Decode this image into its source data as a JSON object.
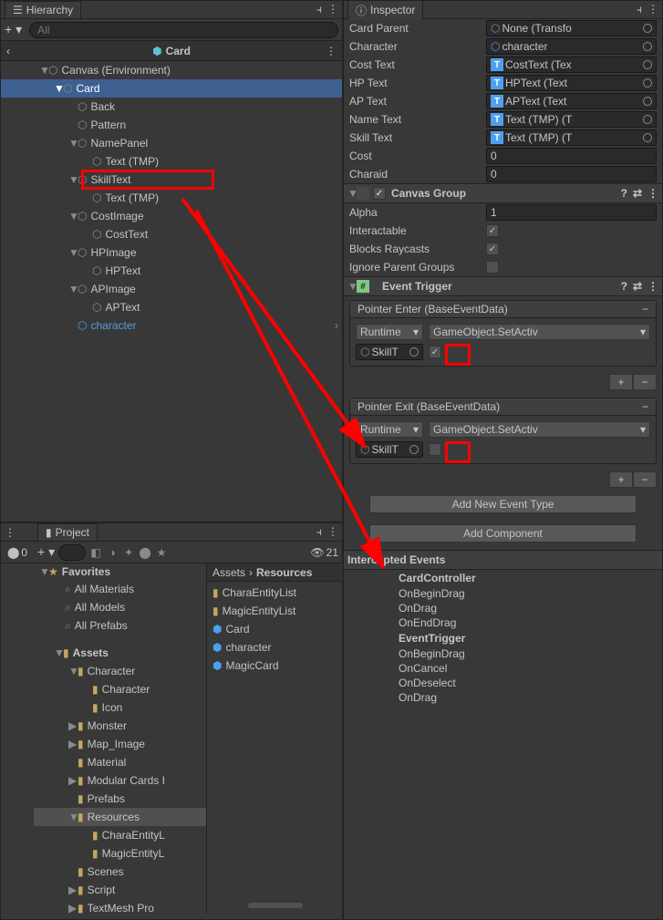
{
  "hierarchy": {
    "title": "Hierarchy",
    "searchPlaceholder": "All",
    "breadcrumb": "Card",
    "items": [
      {
        "label": "Canvas (Environment)",
        "indent": 2,
        "prefab": false,
        "expand": "▼"
      },
      {
        "label": "Card",
        "indent": 3,
        "prefab": false,
        "expand": "▼",
        "selected": true
      },
      {
        "label": "Back",
        "indent": 4,
        "prefab": false,
        "expand": ""
      },
      {
        "label": "Pattern",
        "indent": 4,
        "prefab": false,
        "expand": ""
      },
      {
        "label": "NamePanel",
        "indent": 4,
        "prefab": false,
        "expand": "▼"
      },
      {
        "label": "Text (TMP)",
        "indent": 5,
        "prefab": false,
        "expand": ""
      },
      {
        "label": "SkillText",
        "indent": 4,
        "prefab": false,
        "expand": "▼",
        "redbox": true
      },
      {
        "label": "Text (TMP)",
        "indent": 5,
        "prefab": false,
        "expand": ""
      },
      {
        "label": "CostImage",
        "indent": 4,
        "prefab": false,
        "expand": "▼"
      },
      {
        "label": "CostText",
        "indent": 5,
        "prefab": false,
        "expand": ""
      },
      {
        "label": "HPImage",
        "indent": 4,
        "prefab": false,
        "expand": "▼"
      },
      {
        "label": "HPText",
        "indent": 5,
        "prefab": false,
        "expand": ""
      },
      {
        "label": "APImage",
        "indent": 4,
        "prefab": false,
        "expand": "▼"
      },
      {
        "label": "APText",
        "indent": 5,
        "prefab": false,
        "expand": ""
      },
      {
        "label": "character",
        "indent": 4,
        "prefab": true,
        "expand": ""
      }
    ]
  },
  "project": {
    "title": "Project",
    "errorCount": "0",
    "hiddenCount": "21",
    "favorites": [
      "All Materials",
      "All Models",
      "All Prefabs"
    ],
    "tree": [
      {
        "label": "Assets",
        "indent": 1,
        "expand": "▼",
        "bold": true
      },
      {
        "label": "Character",
        "indent": 2,
        "expand": "▼"
      },
      {
        "label": "Character",
        "indent": 3,
        "expand": ""
      },
      {
        "label": "Icon",
        "indent": 3,
        "expand": ""
      },
      {
        "label": "Monster",
        "indent": 2,
        "expand": "▶"
      },
      {
        "label": "Map_Image",
        "indent": 2,
        "expand": "▶"
      },
      {
        "label": "Material",
        "indent": 2,
        "expand": ""
      },
      {
        "label": "Modular Cards I",
        "indent": 2,
        "expand": "▶"
      },
      {
        "label": "Prefabs",
        "indent": 2,
        "expand": ""
      },
      {
        "label": "Resources",
        "indent": 2,
        "expand": "▼",
        "selected": true
      },
      {
        "label": "CharaEntityL",
        "indent": 3,
        "expand": ""
      },
      {
        "label": "MagicEntityL",
        "indent": 3,
        "expand": ""
      },
      {
        "label": "Scenes",
        "indent": 2,
        "expand": ""
      },
      {
        "label": "Script",
        "indent": 2,
        "expand": "▶"
      },
      {
        "label": "TextMesh Pro",
        "indent": 2,
        "expand": "▶"
      }
    ],
    "breadcrumb": [
      "Assets",
      "Resources"
    ],
    "folderItems": [
      {
        "label": "CharaEntityList",
        "type": "folder"
      },
      {
        "label": "MagicEntityList",
        "type": "folder"
      },
      {
        "label": "Card",
        "type": "prefab"
      },
      {
        "label": "character",
        "type": "prefab"
      },
      {
        "label": "MagicCard",
        "type": "prefab"
      }
    ]
  },
  "inspector": {
    "title": "Inspector",
    "fields": [
      {
        "label": "Card Parent",
        "type": "obj",
        "iconColor": "#8a8a8a",
        "icon": "⬡",
        "value": "None (Transfo"
      },
      {
        "label": "Character",
        "type": "obj",
        "iconColor": "#4f9fef",
        "icon": "⬡",
        "value": "character"
      },
      {
        "label": "Cost Text",
        "type": "obj",
        "tbadge": true,
        "value": "CostText (Tex"
      },
      {
        "label": "HP Text",
        "type": "obj",
        "tbadge": true,
        "value": "HPText (Text"
      },
      {
        "label": "AP Text",
        "type": "obj",
        "tbadge": true,
        "value": "APText (Text"
      },
      {
        "label": "Name Text",
        "type": "obj",
        "tbadge": true,
        "value": "Text (TMP) (T"
      },
      {
        "label": "Skill Text",
        "type": "obj",
        "tbadge": true,
        "value": "Text (TMP) (T"
      },
      {
        "label": "Cost",
        "type": "num",
        "value": "0"
      },
      {
        "label": "Charaid",
        "type": "num",
        "value": "0"
      }
    ],
    "canvasGroup": {
      "title": "Canvas Group",
      "alpha": "1",
      "interactable": true,
      "blocksRaycasts": true,
      "ignoreParentGroups": false
    },
    "eventTrigger": {
      "title": "Event Trigger",
      "events": [
        {
          "name": "Pointer Enter (BaseEventData)",
          "runtime": "Runtime",
          "func": "GameObject.SetActiv",
          "target": "SkillT",
          "checked": true
        },
        {
          "name": "Pointer Exit (BaseEventData)",
          "runtime": "Runtime",
          "func": "GameObject.SetActiv",
          "target": "SkillT",
          "checked": false
        }
      ],
      "addNewEventType": "Add New Event Type"
    },
    "addComponent": "Add Component",
    "intercepted": {
      "title": "Intercepted Events",
      "sections": [
        {
          "head": "CardController",
          "items": [
            "OnBeginDrag",
            "OnDrag",
            "OnEndDrag"
          ]
        },
        {
          "head": "EventTrigger",
          "items": [
            "OnBeginDrag",
            "OnCancel",
            "OnDeselect",
            "OnDrag"
          ]
        }
      ]
    }
  }
}
